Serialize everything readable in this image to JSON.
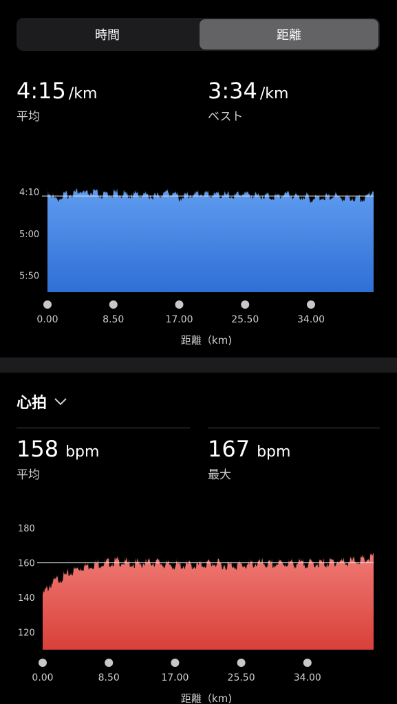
{
  "segmented": {
    "time_label": "時間",
    "distance_label": "距離"
  },
  "pace": {
    "avg_value": "4:15",
    "avg_unit": "/km",
    "avg_label": "平均",
    "best_value": "3:34",
    "best_unit": "/km",
    "best_label": "ベスト"
  },
  "heart": {
    "title": "心拍",
    "avg_value": "158",
    "avg_unit": "bpm",
    "avg_label": "平均",
    "max_value": "167",
    "max_unit": "bpm",
    "max_label": "最大"
  },
  "colors": {
    "pace_fill_top": "#5f9cf0",
    "pace_fill_bottom": "#2f6fd6",
    "hr_fill_top": "#f07a74",
    "hr_fill_bottom": "#d9403a"
  },
  "chart_data": [
    {
      "type": "area",
      "title": "",
      "xlabel": "距離（km)",
      "ylabel": "",
      "x_ticks": [
        "0.00",
        "8.50",
        "17.00",
        "25.50",
        "34.00"
      ],
      "y_ticks": [
        "4:10",
        "5:00",
        "5:50"
      ],
      "ylim_sec_per_km": [
        250,
        350
      ],
      "reference_line": "4:15",
      "x": [
        0,
        1,
        2,
        3,
        4,
        5,
        6,
        7,
        8,
        9,
        10,
        11,
        12,
        13,
        14,
        15,
        16,
        17,
        18,
        19,
        20,
        21,
        22,
        23,
        24,
        25,
        26,
        27,
        28,
        29,
        30,
        31,
        32,
        33,
        34,
        35,
        36,
        37,
        38,
        39,
        40,
        41,
        42
      ],
      "y_sec_per_km": [
        248,
        258,
        254,
        252,
        248,
        252,
        250,
        254,
        252,
        251,
        253,
        252,
        252,
        253,
        255,
        251,
        250,
        256,
        253,
        252,
        251,
        253,
        252,
        253,
        255,
        251,
        252,
        254,
        253,
        255,
        253,
        252,
        255,
        254,
        258,
        256,
        255,
        254,
        257,
        256,
        258,
        256,
        246
      ]
    },
    {
      "type": "area",
      "title": "",
      "xlabel": "距離（km)",
      "ylabel": "",
      "x_ticks": [
        "0.00",
        "8.50",
        "17.00",
        "25.50",
        "34.00"
      ],
      "y_ticks": [
        "180",
        "160",
        "140",
        "120"
      ],
      "ylim": [
        110,
        190
      ],
      "reference_line": 160,
      "x": [
        0,
        1,
        2,
        3,
        4,
        5,
        6,
        7,
        8,
        9,
        10,
        11,
        12,
        13,
        14,
        15,
        16,
        17,
        18,
        19,
        20,
        21,
        22,
        23,
        24,
        25,
        26,
        27,
        28,
        29,
        30,
        31,
        32,
        33,
        34,
        35,
        36,
        37,
        38,
        39,
        40,
        41,
        42
      ],
      "y": [
        142,
        148,
        151,
        153,
        156,
        158,
        159,
        160,
        160,
        161,
        161,
        160,
        160,
        160,
        161,
        160,
        159,
        159,
        159,
        159,
        159,
        160,
        160,
        159,
        159,
        159,
        159,
        160,
        160,
        159,
        160,
        160,
        160,
        160,
        160,
        160,
        160,
        161,
        161,
        161,
        162,
        162,
        164
      ]
    }
  ]
}
